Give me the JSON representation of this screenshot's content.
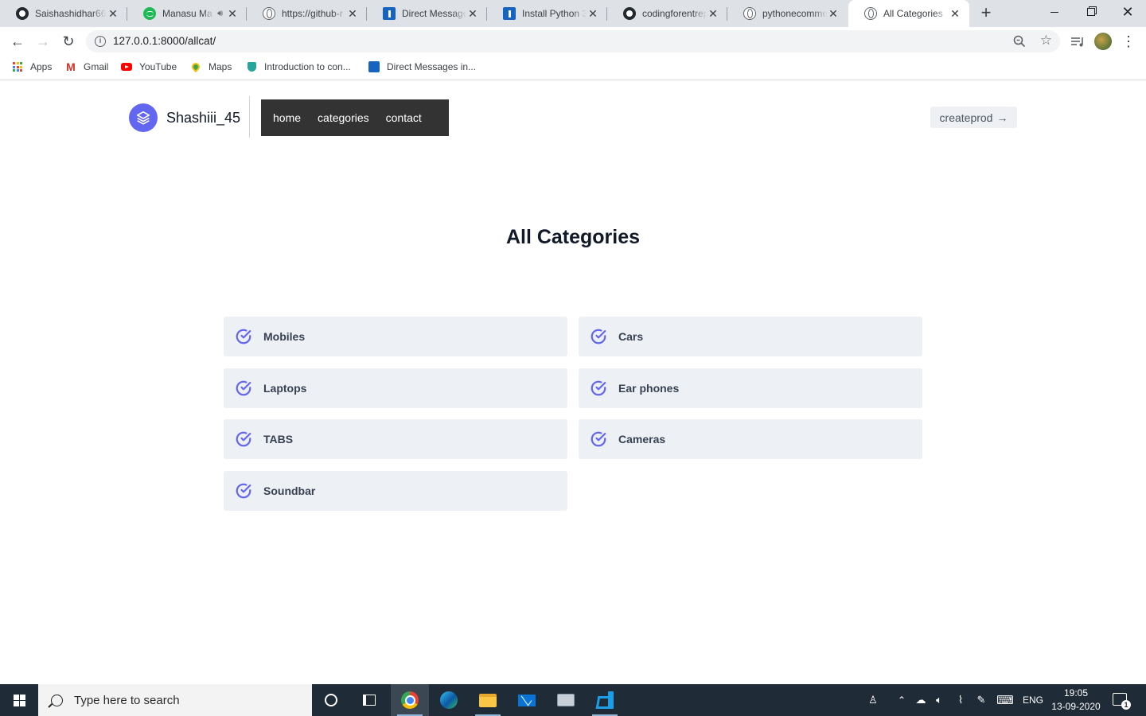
{
  "browser": {
    "tabs": [
      {
        "title": "Saishashidhar66",
        "icon": "github-icon",
        "active": false
      },
      {
        "title": "Manasu Ma",
        "icon": "spotify-icon",
        "active": false,
        "audio": true
      },
      {
        "title": "https://github-r",
        "icon": "globe-icon",
        "active": false
      },
      {
        "title": "Direct Messages",
        "icon": "pythonanywhere-icon",
        "active": false
      },
      {
        "title": "Install Python 3.",
        "icon": "pythonanywhere-icon",
        "active": false
      },
      {
        "title": "codingforentrep",
        "icon": "github-icon",
        "active": false
      },
      {
        "title": "pythonecommerce",
        "icon": "globe-icon",
        "active": false
      },
      {
        "title": "All Categories",
        "icon": "globe-icon",
        "active": true
      }
    ],
    "url": "127.0.0.1:8000/allcat/",
    "bookmarks": [
      {
        "label": "Apps",
        "icon": "apps-grid-icon"
      },
      {
        "label": "Gmail",
        "icon": "gmail-icon"
      },
      {
        "label": "YouTube",
        "icon": "youtube-icon"
      },
      {
        "label": "Maps",
        "icon": "maps-icon"
      },
      {
        "label": "Introduction to con...",
        "icon": "shield-icon"
      },
      {
        "label": "Direct Messages in...",
        "icon": "pythonanywhere-icon"
      }
    ]
  },
  "site": {
    "brand": "Shashiii_45",
    "nav": [
      {
        "label": "home"
      },
      {
        "label": "categories"
      },
      {
        "label": "contact"
      }
    ],
    "cta": {
      "label": "createprod",
      "icon": "arrow-right-icon"
    },
    "heading": "All Categories",
    "categories": [
      {
        "name": "Mobiles"
      },
      {
        "name": "Cars"
      },
      {
        "name": "Laptops"
      },
      {
        "name": "Ear phones"
      },
      {
        "name": "TABS"
      },
      {
        "name": "Cameras"
      },
      {
        "name": "Soundbar"
      }
    ]
  },
  "colors": {
    "accent": "#6366f1",
    "nav_bg": "#333333",
    "card_bg": "#edf0f4",
    "taskbar_bg": "#1f2b37"
  },
  "taskbar": {
    "search_placeholder": "Type here to search",
    "language": "ENG",
    "time": "19:05",
    "date": "13-09-2020",
    "notification_count": "1"
  }
}
